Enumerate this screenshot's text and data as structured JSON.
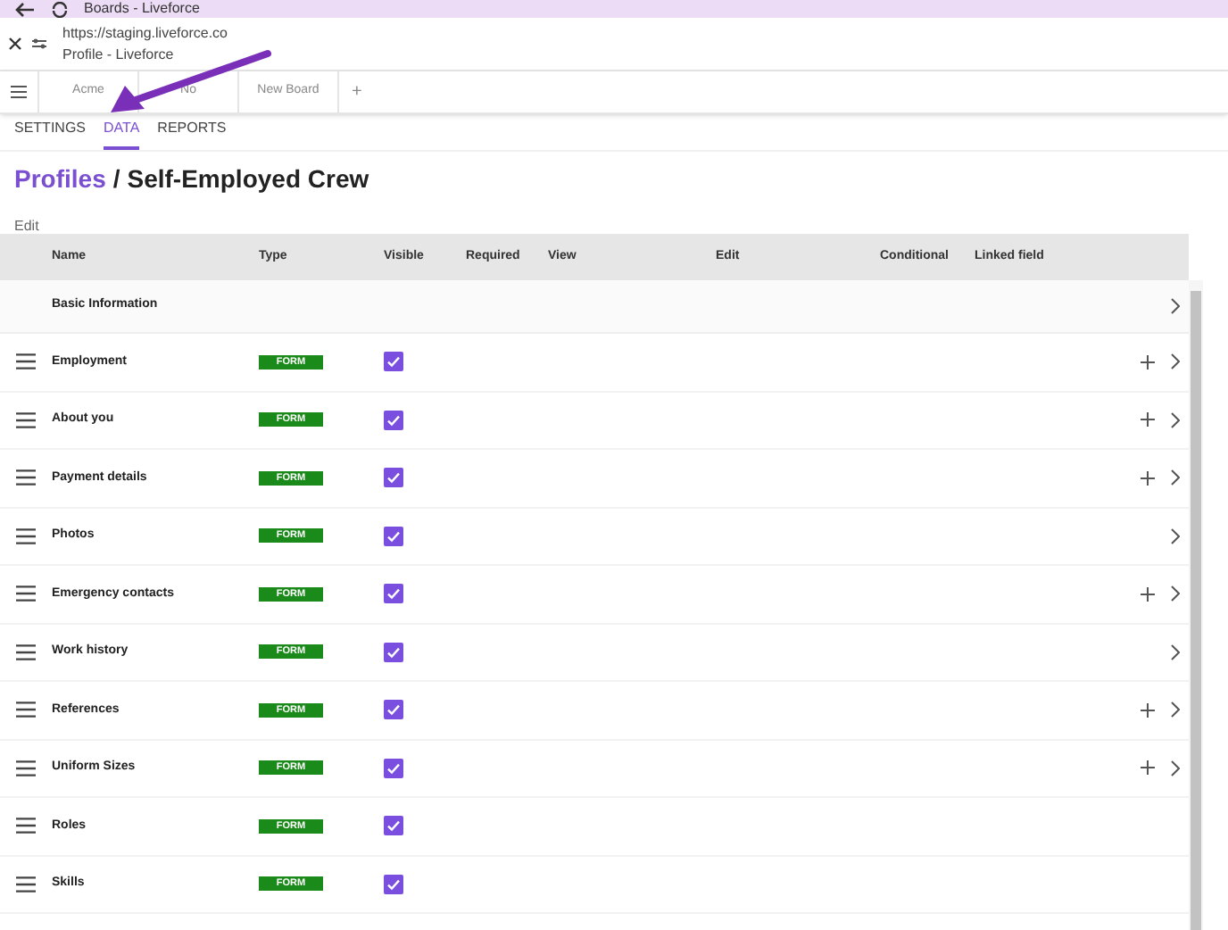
{
  "browser": {
    "title": "Boards - Liveforce",
    "url": "https://staging.liveforce.co",
    "page_title": "Profile - Liveforce"
  },
  "board_tabs": [
    {
      "label": "Acme"
    },
    {
      "label": "No"
    },
    {
      "label": "New Board"
    }
  ],
  "add_tab": "+",
  "sub_tabs": [
    {
      "label": "SETTINGS",
      "selected": false
    },
    {
      "label": "DATA",
      "selected": true
    },
    {
      "label": "REPORTS",
      "selected": false
    }
  ],
  "breadcrumb": {
    "parent": "Profiles",
    "separator": "/",
    "current": "Self-Employed Crew"
  },
  "edit_link": "Edit",
  "table": {
    "columns": [
      "Name",
      "Type",
      "Visible",
      "Required",
      "View",
      "Edit",
      "Conditional",
      "Linked field"
    ],
    "rows": [
      {
        "kind": "section",
        "name": "Basic Information",
        "addable": false,
        "expandable": true
      },
      {
        "kind": "field",
        "name": "Employment",
        "type": "FORM",
        "visible": true,
        "addable": true,
        "expandable": true
      },
      {
        "kind": "field",
        "name": "About you",
        "type": "FORM",
        "visible": true,
        "addable": true,
        "expandable": true
      },
      {
        "kind": "field",
        "name": "Payment details",
        "type": "FORM",
        "visible": true,
        "addable": true,
        "expandable": true
      },
      {
        "kind": "field",
        "name": "Photos",
        "type": "FORM",
        "visible": true,
        "addable": false,
        "expandable": true
      },
      {
        "kind": "field",
        "name": "Emergency contacts",
        "type": "FORM",
        "visible": true,
        "addable": true,
        "expandable": true
      },
      {
        "kind": "field",
        "name": "Work history",
        "type": "FORM",
        "visible": true,
        "addable": false,
        "expandable": true
      },
      {
        "kind": "field",
        "name": "References",
        "type": "FORM",
        "visible": true,
        "addable": true,
        "expandable": true
      },
      {
        "kind": "field",
        "name": "Uniform Sizes",
        "type": "FORM",
        "visible": true,
        "addable": true,
        "expandable": true
      },
      {
        "kind": "field",
        "name": "Roles",
        "type": "FORM",
        "visible": true,
        "addable": false,
        "expandable": false
      },
      {
        "kind": "field",
        "name": "Skills",
        "type": "FORM",
        "visible": true,
        "addable": false,
        "expandable": false
      }
    ]
  }
}
